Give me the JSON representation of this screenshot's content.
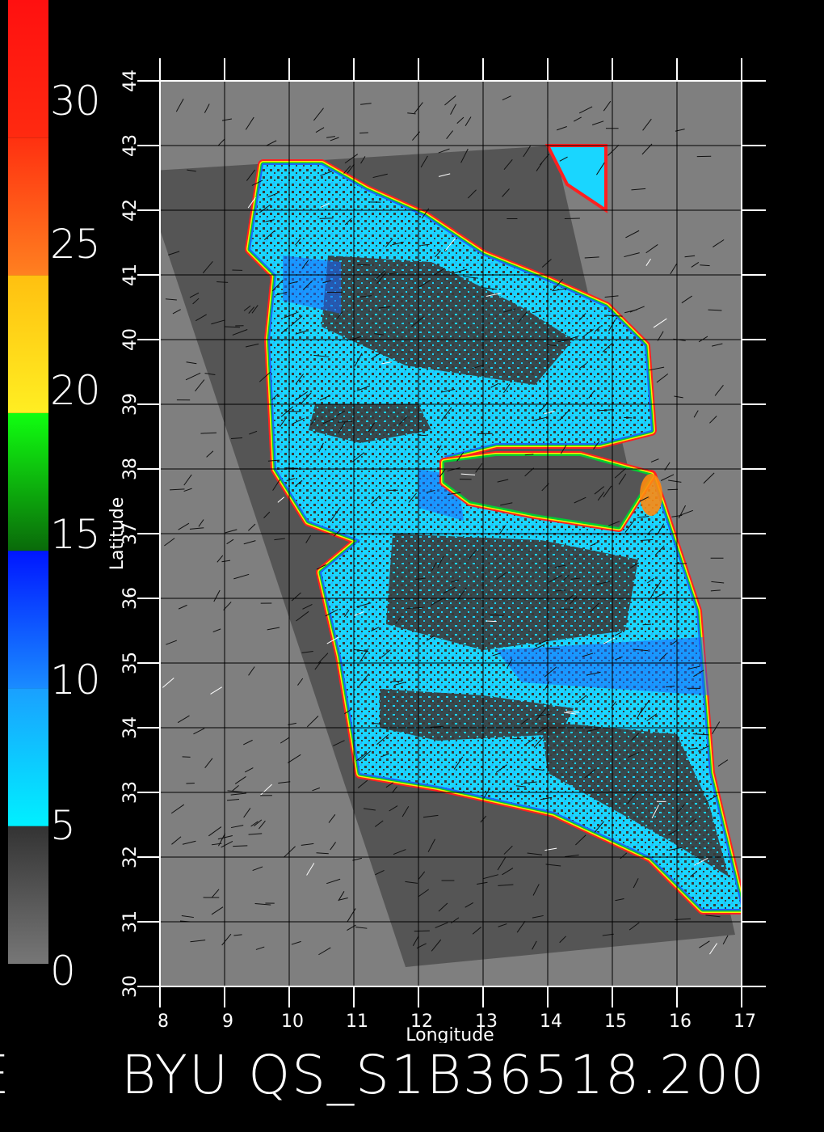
{
  "title": {
    "left_fragment": "E",
    "main": "BYU QS_S1B36518.200"
  },
  "colorbar": {
    "labels": [
      "30",
      "25",
      "20",
      "15",
      "10",
      "5",
      "0"
    ],
    "segments": [
      {
        "from": 0,
        "to": 5,
        "colors": [
          "#777777",
          "#333333"
        ]
      },
      {
        "from": 5,
        "to": 10,
        "colors": [
          "#00f0ff",
          "#1aa0ff"
        ]
      },
      {
        "from": 10,
        "to": 15,
        "colors": [
          "#1a8cff",
          "#0016ff"
        ]
      },
      {
        "from": 15,
        "to": 20,
        "colors": [
          "#0a6a0a",
          "#10ff10"
        ]
      },
      {
        "from": 20,
        "to": 25,
        "colors": [
          "#ffee22",
          "#ffc010"
        ]
      },
      {
        "from": 25,
        "to": 30,
        "colors": [
          "#ff8020",
          "#ff3010"
        ]
      },
      {
        "from": 30,
        "to": 35,
        "colors": [
          "#ff2a10",
          "#ff1010"
        ]
      }
    ]
  },
  "axes": {
    "x_label": "Longitude",
    "y_label": "Latitude",
    "x_range": [
      8,
      17
    ],
    "y_range": [
      30,
      44
    ],
    "x_ticks": [
      "8",
      "9",
      "10",
      "11",
      "12",
      "13",
      "14",
      "15",
      "16",
      "17"
    ],
    "y_ticks": [
      "30",
      "31",
      "32",
      "33",
      "34",
      "35",
      "36",
      "37",
      "38",
      "39",
      "40",
      "41",
      "42",
      "43",
      "44"
    ],
    "grid": true
  },
  "colors": {
    "background": "#000000",
    "land": "#7f7f7f",
    "swath": "#555555",
    "grid": "#000000",
    "low_wind": "#3a3a3a",
    "wind_cyan": "#19d6ff",
    "wind_blue": "#1a66ff",
    "coast_red": "#ff2020",
    "coast_yellow": "#ffee00",
    "coast_green": "#00cc33"
  },
  "map": {
    "swath_corners_lonlat": [
      [
        7.7,
        42.6
      ],
      [
        14.1,
        43.0
      ],
      [
        16.9,
        30.8
      ],
      [
        11.8,
        30.3
      ]
    ],
    "wind_field_lonlat": [
      [
        9.6,
        42.7
      ],
      [
        10.5,
        42.7
      ],
      [
        11.2,
        42.3
      ],
      [
        12.1,
        41.9
      ],
      [
        13.0,
        41.3
      ],
      [
        14.0,
        40.9
      ],
      [
        14.9,
        40.5
      ],
      [
        15.5,
        39.9
      ],
      [
        15.6,
        38.6
      ],
      [
        14.8,
        38.4
      ],
      [
        13.2,
        38.4
      ],
      [
        12.4,
        38.2
      ],
      [
        12.7,
        37.6
      ],
      [
        13.8,
        37.3
      ],
      [
        15.1,
        37.1
      ],
      [
        15.6,
        37.9
      ],
      [
        16.3,
        35.8
      ],
      [
        16.5,
        33.3
      ],
      [
        17.0,
        31.2
      ],
      [
        16.4,
        31.2
      ],
      [
        15.6,
        32.0
      ],
      [
        14.1,
        32.7
      ],
      [
        12.3,
        33.1
      ],
      [
        11.1,
        33.3
      ],
      [
        10.8,
        35.1
      ],
      [
        10.5,
        36.4
      ],
      [
        11.1,
        36.9
      ],
      [
        10.3,
        37.2
      ],
      [
        9.8,
        38.0
      ],
      [
        9.7,
        40.0
      ],
      [
        9.8,
        41.0
      ],
      [
        9.4,
        41.4
      ]
    ],
    "calm_region_lonlat": [
      [
        12.4,
        38.1
      ],
      [
        13.2,
        38.2
      ],
      [
        14.5,
        38.2
      ],
      [
        15.6,
        37.9
      ],
      [
        15.1,
        37.1
      ],
      [
        13.8,
        37.3
      ],
      [
        12.8,
        37.5
      ],
      [
        12.4,
        37.8
      ]
    ],
    "upper_right_patch_lonlat": [
      [
        14.0,
        43.0
      ],
      [
        14.9,
        43.0
      ],
      [
        14.9,
        42.0
      ],
      [
        14.3,
        42.4
      ]
    ]
  }
}
